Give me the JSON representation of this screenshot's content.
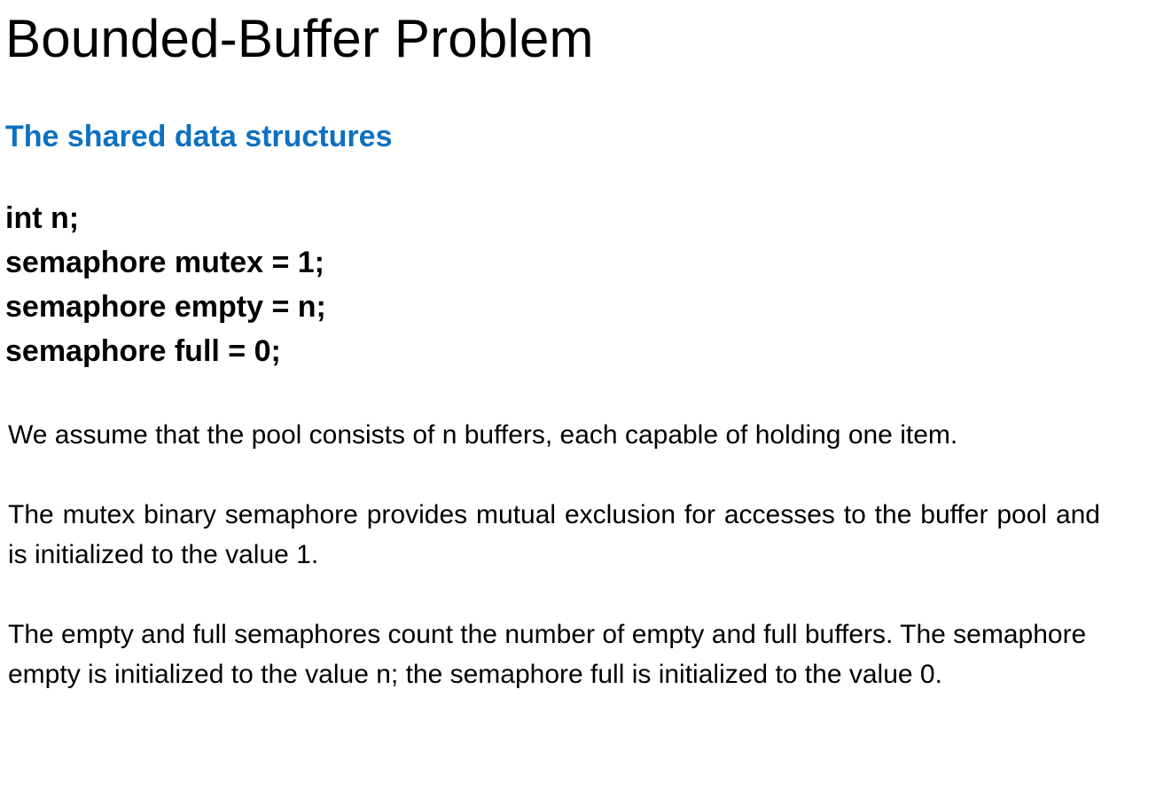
{
  "slide": {
    "title": "Bounded-Buffer Problem",
    "subtitle": "The shared data structures",
    "code_lines": [
      "int n;",
      "semaphore mutex = 1;",
      "semaphore empty = n;",
      "semaphore full = 0;"
    ],
    "paragraphs": [
      "We assume that the pool consists of n buffers, each capable of holding one item.",
      "The mutex binary semaphore provides mutual exclusion for accesses to the buffer pool and is initialized to the value 1.",
      "The empty and full semaphores count the number of empty and full buffers. The semaphore empty is initialized to the value n; the semaphore full is initialized to the value 0."
    ]
  },
  "colors": {
    "subtitle": "#0e70c0",
    "text": "#000000",
    "background": "#ffffff"
  }
}
